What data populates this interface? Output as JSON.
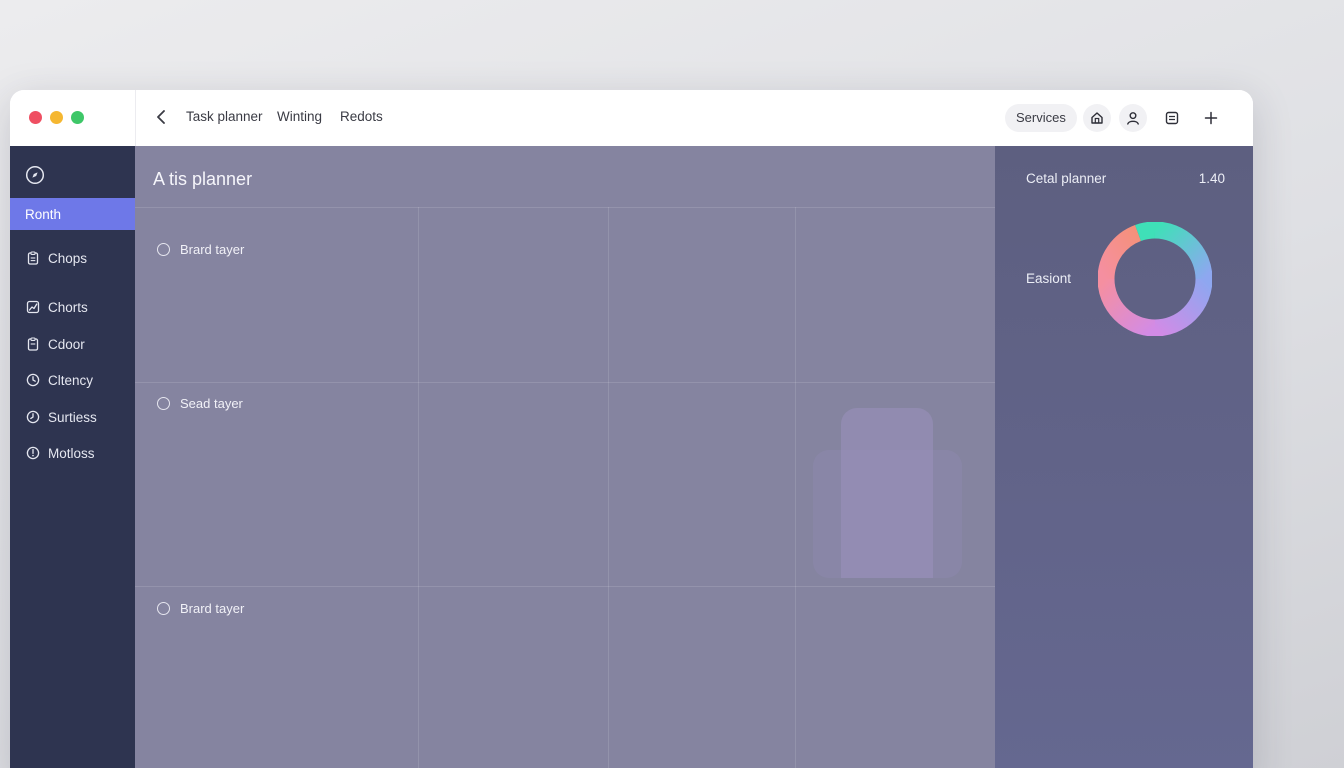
{
  "titlebar": {
    "nav_links": [
      "Task planner",
      "Winting",
      "Redots"
    ],
    "services_label": "Services",
    "icons": [
      "home-icon",
      "user-icon",
      "document-icon",
      "plus-icon"
    ],
    "traffic_lights": [
      "#ef4f62",
      "#f5b731",
      "#3ec768"
    ]
  },
  "sidebar": {
    "top_icon": "compass-icon",
    "items": [
      {
        "label": "Ronth",
        "icon": "",
        "active": true
      },
      {
        "label": "Chops",
        "icon": "clipboard-icon"
      },
      {
        "label": "Chorts",
        "icon": "chart-icon"
      },
      {
        "label": "Cdoor",
        "icon": "clipboard-icon"
      },
      {
        "label": "Cltency",
        "icon": "clock-icon"
      },
      {
        "label": "Surtiess",
        "icon": "clock-icon"
      },
      {
        "label": "Motloss",
        "icon": "clock-icon"
      }
    ],
    "active_color": "#6e78e8"
  },
  "main": {
    "title": "A tis planner",
    "rows": [
      {
        "label": "Brard tayer"
      },
      {
        "label": "Sead tayer"
      },
      {
        "label": "Brard tayer"
      }
    ]
  },
  "right_panel": {
    "title": "Cetal planner",
    "value": "1.40",
    "label": "Easiont",
    "donut_colors": [
      "#3fe0b8",
      "#8ea7f0",
      "#d28be6",
      "#f58fa0",
      "#f5917a"
    ]
  }
}
